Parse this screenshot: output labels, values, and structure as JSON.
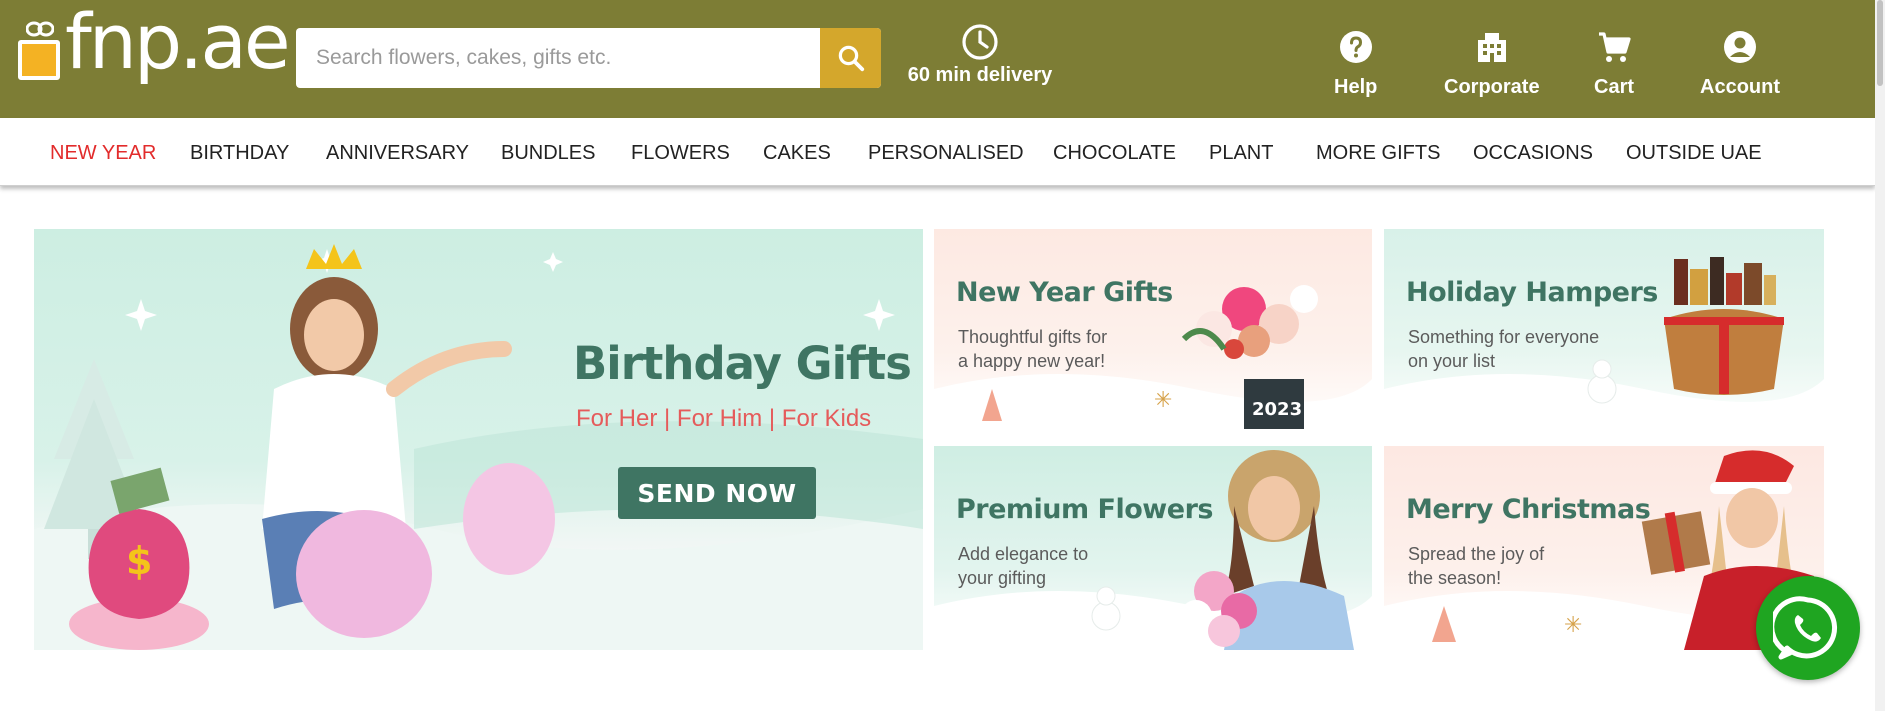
{
  "colors": {
    "brand": "#7d7d35",
    "accent": "#d4a72c",
    "active_nav": "#e22b2b",
    "banner_green": "#3f7563"
  },
  "header": {
    "logo_text": "fnp.ae",
    "search": {
      "placeholder": "Search flowers, cakes, gifts etc.",
      "value": ""
    },
    "delivery_label": "60 min delivery",
    "nav": [
      {
        "label": "Help",
        "icon": "help-icon"
      },
      {
        "label": "Corporate",
        "icon": "building-icon"
      },
      {
        "label": "Cart",
        "icon": "cart-icon"
      },
      {
        "label": "Account",
        "icon": "account-icon"
      }
    ]
  },
  "categories": [
    {
      "label": "NEW YEAR",
      "active": true
    },
    {
      "label": "BIRTHDAY"
    },
    {
      "label": "ANNIVERSARY"
    },
    {
      "label": "BUNDLES"
    },
    {
      "label": "FLOWERS"
    },
    {
      "label": "CAKES"
    },
    {
      "label": "PERSONALISED"
    },
    {
      "label": "CHOCOLATE"
    },
    {
      "label": "PLANT"
    },
    {
      "label": "MORE GIFTS"
    },
    {
      "label": "OCCASIONS"
    },
    {
      "label": "OUTSIDE UAE"
    }
  ],
  "banners": {
    "main": {
      "title": "Birthday Gifts",
      "subtitle": "For Her | For Him | For Kids",
      "cta": "SEND NOW"
    },
    "tiles": [
      {
        "title": "New Year Gifts",
        "line1": "Thoughtful gifts for",
        "line2": "a happy new year!"
      },
      {
        "title": "Holiday Hampers",
        "line1": "Something for everyone",
        "line2": "on your list"
      },
      {
        "title": "Premium Flowers",
        "line1": "Add elegance to",
        "line2": "your gifting"
      },
      {
        "title": "Merry Christmas",
        "line1": "Spread the joy of",
        "line2": "the season!"
      }
    ]
  },
  "whatsapp_icon": "whatsapp-icon"
}
